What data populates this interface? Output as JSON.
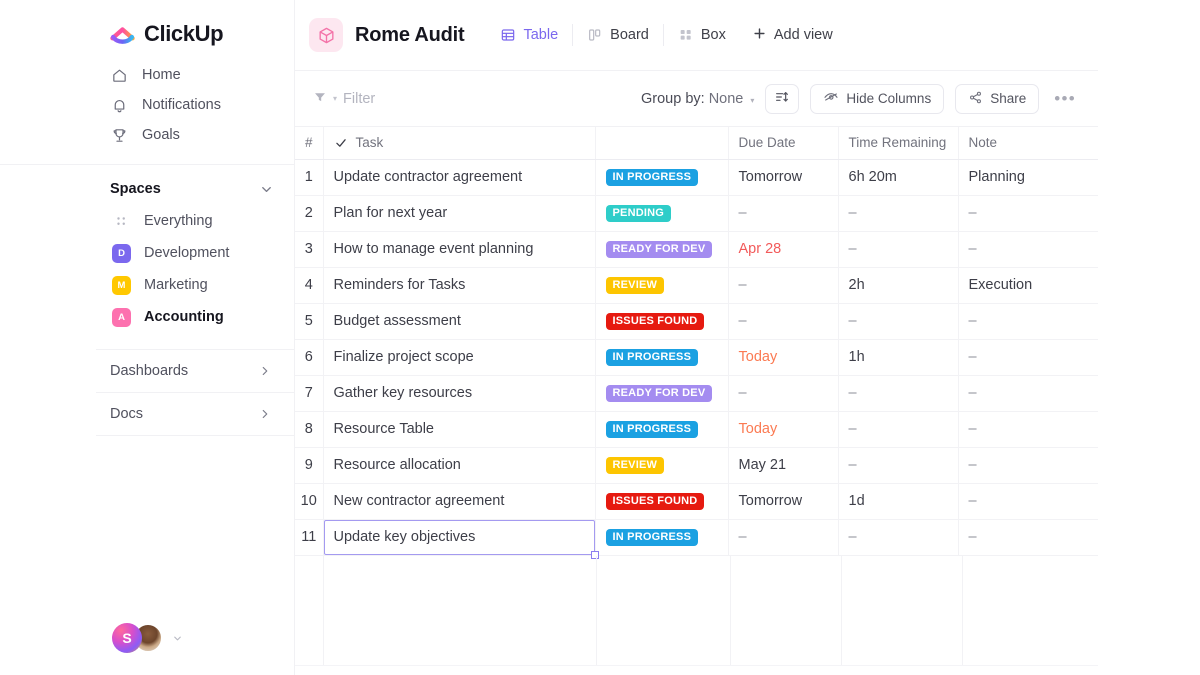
{
  "sidebar": {
    "brand": {
      "name": "ClickUp",
      "logo_icon": "clickup-logo-icon"
    },
    "nav": [
      {
        "label": "Home",
        "icon": "home-icon"
      },
      {
        "label": "Notifications",
        "icon": "bell-icon"
      },
      {
        "label": "Goals",
        "icon": "trophy-icon"
      }
    ],
    "spaces": {
      "title": "Spaces",
      "collapse_icon": "chevron-down-icon",
      "items": [
        {
          "label": "Everything",
          "icon": "grid-dots-icon",
          "initial": "",
          "color": "",
          "active": false
        },
        {
          "label": "Development",
          "icon": "space-square",
          "initial": "D",
          "color": "#7b68ee",
          "active": false
        },
        {
          "label": "Marketing",
          "icon": "space-square",
          "initial": "M",
          "color": "#ffc800",
          "active": false
        },
        {
          "label": "Accounting",
          "icon": "space-square",
          "initial": "A",
          "color": "#fd71af",
          "active": true
        }
      ]
    },
    "footer_items": [
      {
        "label": "Dashboards",
        "icon": "chevron-right-icon"
      },
      {
        "label": "Docs",
        "icon": "chevron-right-icon"
      }
    ],
    "user": {
      "initial": "S",
      "avatar_icon": "user-avatar",
      "caret_icon": "chevron-down-icon"
    }
  },
  "header": {
    "project_icon": "cube-icon",
    "project_title": "Rome Audit",
    "tabs": [
      {
        "label": "Table",
        "icon": "table-icon",
        "active": true
      },
      {
        "label": "Board",
        "icon": "board-icon",
        "active": false
      },
      {
        "label": "Box",
        "icon": "box-icon",
        "active": false
      }
    ],
    "add_view": {
      "label": "Add view",
      "icon": "plus-icon"
    }
  },
  "toolbar": {
    "filter": {
      "label": "Filter",
      "icon": "filter-icon",
      "caret": "▾"
    },
    "group_by": {
      "label": "Group by:",
      "value": "None",
      "caret": "▾"
    },
    "sort_button": {
      "icon": "sort-icon"
    },
    "hide_columns": {
      "label": "Hide Columns",
      "icon": "eye-slash-icon"
    },
    "share": {
      "label": "Share",
      "icon": "share-icon"
    },
    "more": {
      "label": "•••"
    }
  },
  "table": {
    "columns": [
      {
        "key": "num",
        "label": "#"
      },
      {
        "key": "task",
        "label": "Task",
        "icon": "check-icon"
      },
      {
        "key": "status",
        "label": ""
      },
      {
        "key": "due",
        "label": "Due Date"
      },
      {
        "key": "time",
        "label": "Time Remaining"
      },
      {
        "key": "note",
        "label": "Note"
      }
    ],
    "status_colors": {
      "IN PROGRESS": "#1ba1e2",
      "PENDING": "#2ecdc9",
      "READY FOR DEV": "#a48cf0",
      "REVIEW": "#fdc500",
      "ISSUES FOUND": "#e61a10"
    },
    "rows": [
      {
        "num": "1",
        "task": "Update contractor agreement",
        "status": "IN PROGRESS",
        "due": "Tomorrow",
        "due_style": "normal",
        "time": "6h 20m",
        "note": "Planning"
      },
      {
        "num": "2",
        "task": "Plan for next year",
        "status": "PENDING",
        "due": "–",
        "due_style": "dash",
        "time": "–",
        "note": "–"
      },
      {
        "num": "3",
        "task": "How to manage event planning",
        "status": "READY FOR DEV",
        "due": "Apr 28",
        "due_style": "red",
        "time": "–",
        "note": "–"
      },
      {
        "num": "4",
        "task": "Reminders for Tasks",
        "status": "REVIEW",
        "due": "–",
        "due_style": "dash",
        "time": "2h",
        "note": "Execution"
      },
      {
        "num": "5",
        "task": "Budget assessment",
        "status": "ISSUES FOUND",
        "due": "–",
        "due_style": "dash",
        "time": "–",
        "note": "–"
      },
      {
        "num": "6",
        "task": "Finalize project scope",
        "status": "IN PROGRESS",
        "due": "Today",
        "due_style": "orange",
        "time": "1h",
        "note": "–"
      },
      {
        "num": "7",
        "task": "Gather key resources",
        "status": "READY FOR DEV",
        "due": "–",
        "due_style": "dash",
        "time": "–",
        "note": "–"
      },
      {
        "num": "8",
        "task": "Resource Table",
        "status": "IN PROGRESS",
        "due": "Today",
        "due_style": "orange",
        "time": "–",
        "note": "–"
      },
      {
        "num": "9",
        "task": "Resource allocation",
        "status": "REVIEW",
        "due": "May 21",
        "due_style": "normal",
        "time": "–",
        "note": "–"
      },
      {
        "num": "10",
        "task": "New contractor agreement",
        "status": "ISSUES FOUND",
        "due": "Tomorrow",
        "due_style": "normal",
        "time": "1d",
        "note": "–"
      },
      {
        "num": "11",
        "task": "Update key objectives",
        "status": "IN PROGRESS",
        "due": "–",
        "due_style": "dash",
        "time": "–",
        "note": "–",
        "selected": true
      }
    ]
  },
  "colors": {
    "accent": "#7b68ee",
    "selection_border": "#a49af0",
    "text": "#3d3e48",
    "muted": "#8b8c97"
  }
}
